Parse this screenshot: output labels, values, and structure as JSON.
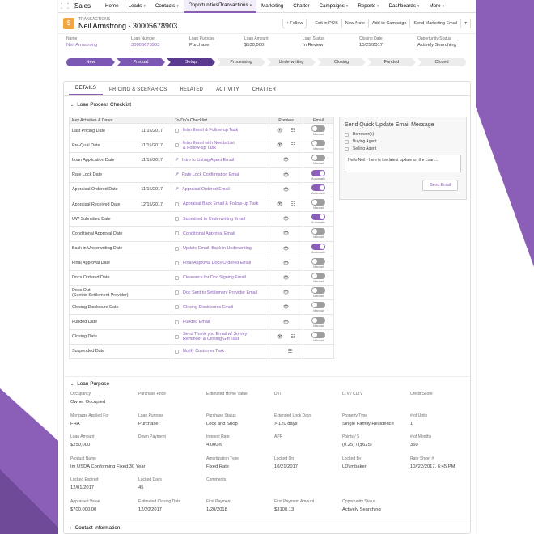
{
  "nav": {
    "app_name": "Sales",
    "items": [
      {
        "label": "Home",
        "caret": false
      },
      {
        "label": "Leads",
        "caret": true
      },
      {
        "label": "Contacts",
        "caret": true
      },
      {
        "label": "Opportunities/Transactions",
        "caret": true
      },
      {
        "label": "Marketing",
        "caret": false
      },
      {
        "label": "Chatter",
        "caret": false
      },
      {
        "label": "Campaigns",
        "caret": true
      },
      {
        "label": "Reports",
        "caret": true
      },
      {
        "label": "Dashboards",
        "caret": true
      },
      {
        "label": "More",
        "caret": true
      }
    ]
  },
  "header": {
    "type": "TRANSACTIONS",
    "title": "Neil Armstrong - 30005678903",
    "follow": "+ Follow",
    "buttons": [
      "Edit in POS",
      "New Note",
      "Add to Campaign",
      "Send Marketing Email"
    ]
  },
  "highlights": [
    {
      "label": "Name",
      "value": "Neil Armstrong",
      "link": true
    },
    {
      "label": "Loan Number",
      "value": "30005678903",
      "link": true
    },
    {
      "label": "Loan Purpose",
      "value": "Purchase",
      "link": false
    },
    {
      "label": "Loan Amount",
      "value": "$530,000",
      "link": false
    },
    {
      "label": "Loan Status",
      "value": "In Review",
      "link": false
    },
    {
      "label": "Closing Date",
      "value": "10/25/2017",
      "link": false
    },
    {
      "label": "Opportunity Status",
      "value": "Actively Searching",
      "link": false
    }
  ],
  "path": [
    "New",
    "Prequal",
    "Setup",
    "Processing",
    "Underwriting",
    "Closing",
    "Funded",
    "Closed"
  ],
  "tabs": [
    "DETAILS",
    "PRICING & SCENARIOS",
    "RELATED",
    "ACTIVITY",
    "CHATTER"
  ],
  "checklist": {
    "section": "Loan Process Checklist",
    "headers": [
      "Key Activities & Dates",
      "To-Do's Checklist",
      "Preview",
      "Email"
    ],
    "rows": [
      {
        "activity": "Last Pricing Date",
        "date": "11/15/2017",
        "todo": "Intro Email & Follow-up Task",
        "todo2": "",
        "icon": "box",
        "eye": true,
        "task": true,
        "toggle": "Manual",
        "on": false
      },
      {
        "activity": "Pre-Qual Date",
        "date": "11/15/2017",
        "todo": "Intro Email with Needs List",
        "todo2": "& Follow-up Task",
        "icon": "box",
        "eye": true,
        "task": true,
        "toggle": "Manual",
        "on": false
      },
      {
        "activity": "Loan Application Date",
        "date": "11/15/2017",
        "todo": "Intro to Listing Agent Email",
        "todo2": "",
        "icon": "share",
        "eye": true,
        "task": false,
        "toggle": "Manual",
        "on": false
      },
      {
        "activity": "Rate Lock Date",
        "date": "",
        "todo": "Rate Lock Confirmation Email",
        "todo2": "",
        "icon": "share",
        "eye": true,
        "task": false,
        "toggle": "Automatic",
        "on": true
      },
      {
        "activity": "Appraisal Ordered Date",
        "date": "11/15/2017",
        "todo": "Appraisal Ordered Email",
        "todo2": "",
        "icon": "share",
        "eye": true,
        "task": false,
        "toggle": "Automatic",
        "on": true
      },
      {
        "activity": "Appraisal Received Date",
        "date": "12/15/2017",
        "todo": "Appraisal Back Email & Follow-up Task",
        "todo2": "",
        "icon": "box",
        "eye": true,
        "task": true,
        "toggle": "Manual",
        "on": false
      },
      {
        "activity": "UW Submitted Date",
        "date": "",
        "todo": "Submitted to Underwriting Email",
        "todo2": "",
        "icon": "box",
        "eye": true,
        "task": false,
        "toggle": "Automatic",
        "on": true
      },
      {
        "activity": "Conditional Approval Date",
        "date": "",
        "todo": "Conditional Approval Email",
        "todo2": "",
        "icon": "box",
        "eye": true,
        "task": false,
        "toggle": "Manual",
        "on": false
      },
      {
        "activity": "Back in Underwriting Date",
        "date": "",
        "todo": "Update Email, Back in Underwriting",
        "todo2": "",
        "icon": "box",
        "eye": true,
        "task": false,
        "toggle": "Automatic",
        "on": true
      },
      {
        "activity": "Final Approval Date",
        "date": "",
        "todo": "Final Approval Docs Ordered Email",
        "todo2": "",
        "icon": "box",
        "eye": true,
        "task": false,
        "toggle": "Manual",
        "on": false
      },
      {
        "activity": "Docs Ordered Date",
        "date": "",
        "todo": "Clearance for Doc Signing Email",
        "todo2": "",
        "icon": "box",
        "eye": true,
        "task": false,
        "toggle": "Manual",
        "on": false
      },
      {
        "activity": "Docs Out",
        "activity2": "(Sent to Settlement Provider)",
        "date": "",
        "todo": "Doc Sent to Settlement Provider Email",
        "todo2": "",
        "icon": "box",
        "eye": true,
        "task": false,
        "toggle": "Manual",
        "on": false
      },
      {
        "activity": "Closing Disclosure Date",
        "date": "",
        "todo": "Closing Disclosures Email",
        "todo2": "",
        "icon": "box",
        "eye": true,
        "task": false,
        "toggle": "Manual",
        "on": false
      },
      {
        "activity": "Funded Date",
        "date": "",
        "todo": "Funded Email",
        "todo2": "",
        "icon": "box",
        "eye": true,
        "task": false,
        "toggle": "Manual",
        "on": false
      },
      {
        "activity": "Closing Date",
        "date": "",
        "todo": "Send Thank you Email w/ Survey",
        "todo2": "Reminder & Closing Gift Task",
        "icon": "box",
        "eye": true,
        "task": true,
        "toggle": "Manual",
        "on": false
      },
      {
        "activity": "Suspended Date",
        "date": "",
        "todo": "Notify Customer Task",
        "todo2": "",
        "icon": "box",
        "eye": false,
        "task": true,
        "toggle": "",
        "on": false
      }
    ]
  },
  "quick": {
    "title": "Send Quick Update Email Message",
    "options": [
      "Borrower(s)",
      "Buying Agent",
      "Selling Agent"
    ],
    "message": "Hello Neil - here is the latest update on the Loan...",
    "send": "Send Email"
  },
  "loan_purpose": {
    "section": "Loan Purpose",
    "fields": [
      {
        "label": "Occupancy",
        "value": "Owner Occupied"
      },
      {
        "label": "Purchase Price",
        "value": ""
      },
      {
        "label": "Estimated Home Value",
        "value": ""
      },
      {
        "label": "DTI",
        "value": ""
      },
      {
        "label": "LTV / CLTV",
        "value": ""
      },
      {
        "label": "Credit Score",
        "value": ""
      },
      {
        "label": "Mortgage Applied For",
        "value": "FHA"
      },
      {
        "label": "Loan Purpose",
        "value": "Purchase"
      },
      {
        "label": "Purchase Status",
        "value": "Lock and Shop"
      },
      {
        "label": "Extended Lock Days",
        "value": "> 120 days"
      },
      {
        "label": "Property Type",
        "value": "Single Family Residence"
      },
      {
        "label": "# of Units",
        "value": "1"
      },
      {
        "label": "Loan Amount",
        "value": "$250,000"
      },
      {
        "label": "Down Payment",
        "value": ""
      },
      {
        "label": "Interest Rate",
        "value": "4.000%"
      },
      {
        "label": "APR",
        "value": ""
      },
      {
        "label": "Points / $",
        "value": "(0.25) / ($625)"
      },
      {
        "label": "# of Months",
        "value": "360"
      },
      {
        "label": "Product Name",
        "value": "Im USDA Conforming Fixed 30 Year"
      },
      {
        "label": "",
        "value": ""
      },
      {
        "label": "Amortization Type",
        "value": "Fixed Rate"
      },
      {
        "label": "Locked On",
        "value": "10/21/2017"
      },
      {
        "label": "Locked By",
        "value": "LD\\imbaker"
      },
      {
        "label": "Rate Sheet #",
        "value": "10//22/2017, 6:45 PM"
      },
      {
        "label": "Locked Expired",
        "value": "12/01/2017"
      },
      {
        "label": "Locked Days",
        "value": "45"
      },
      {
        "label": "Comments",
        "value": ""
      },
      {
        "label": "",
        "value": ""
      },
      {
        "label": "",
        "value": ""
      },
      {
        "label": "",
        "value": ""
      },
      {
        "label": "Appraised Value",
        "value": "$700,000.00"
      },
      {
        "label": "Estimated Closing Date",
        "value": "12/20/2017"
      },
      {
        "label": "First Payment",
        "value": "1/20/2018"
      },
      {
        "label": "First Payment Amount",
        "value": "$3100.13"
      },
      {
        "label": "Opportunity Status",
        "value": "Actively Searching"
      },
      {
        "label": "",
        "value": ""
      }
    ]
  },
  "contact": {
    "section": "Contact Information"
  },
  "colors": {
    "accent": "#8b5fb8",
    "stage_done": "#7a58b3",
    "stage_current": "#5a3a8e",
    "record_icon": "#f2a541"
  }
}
